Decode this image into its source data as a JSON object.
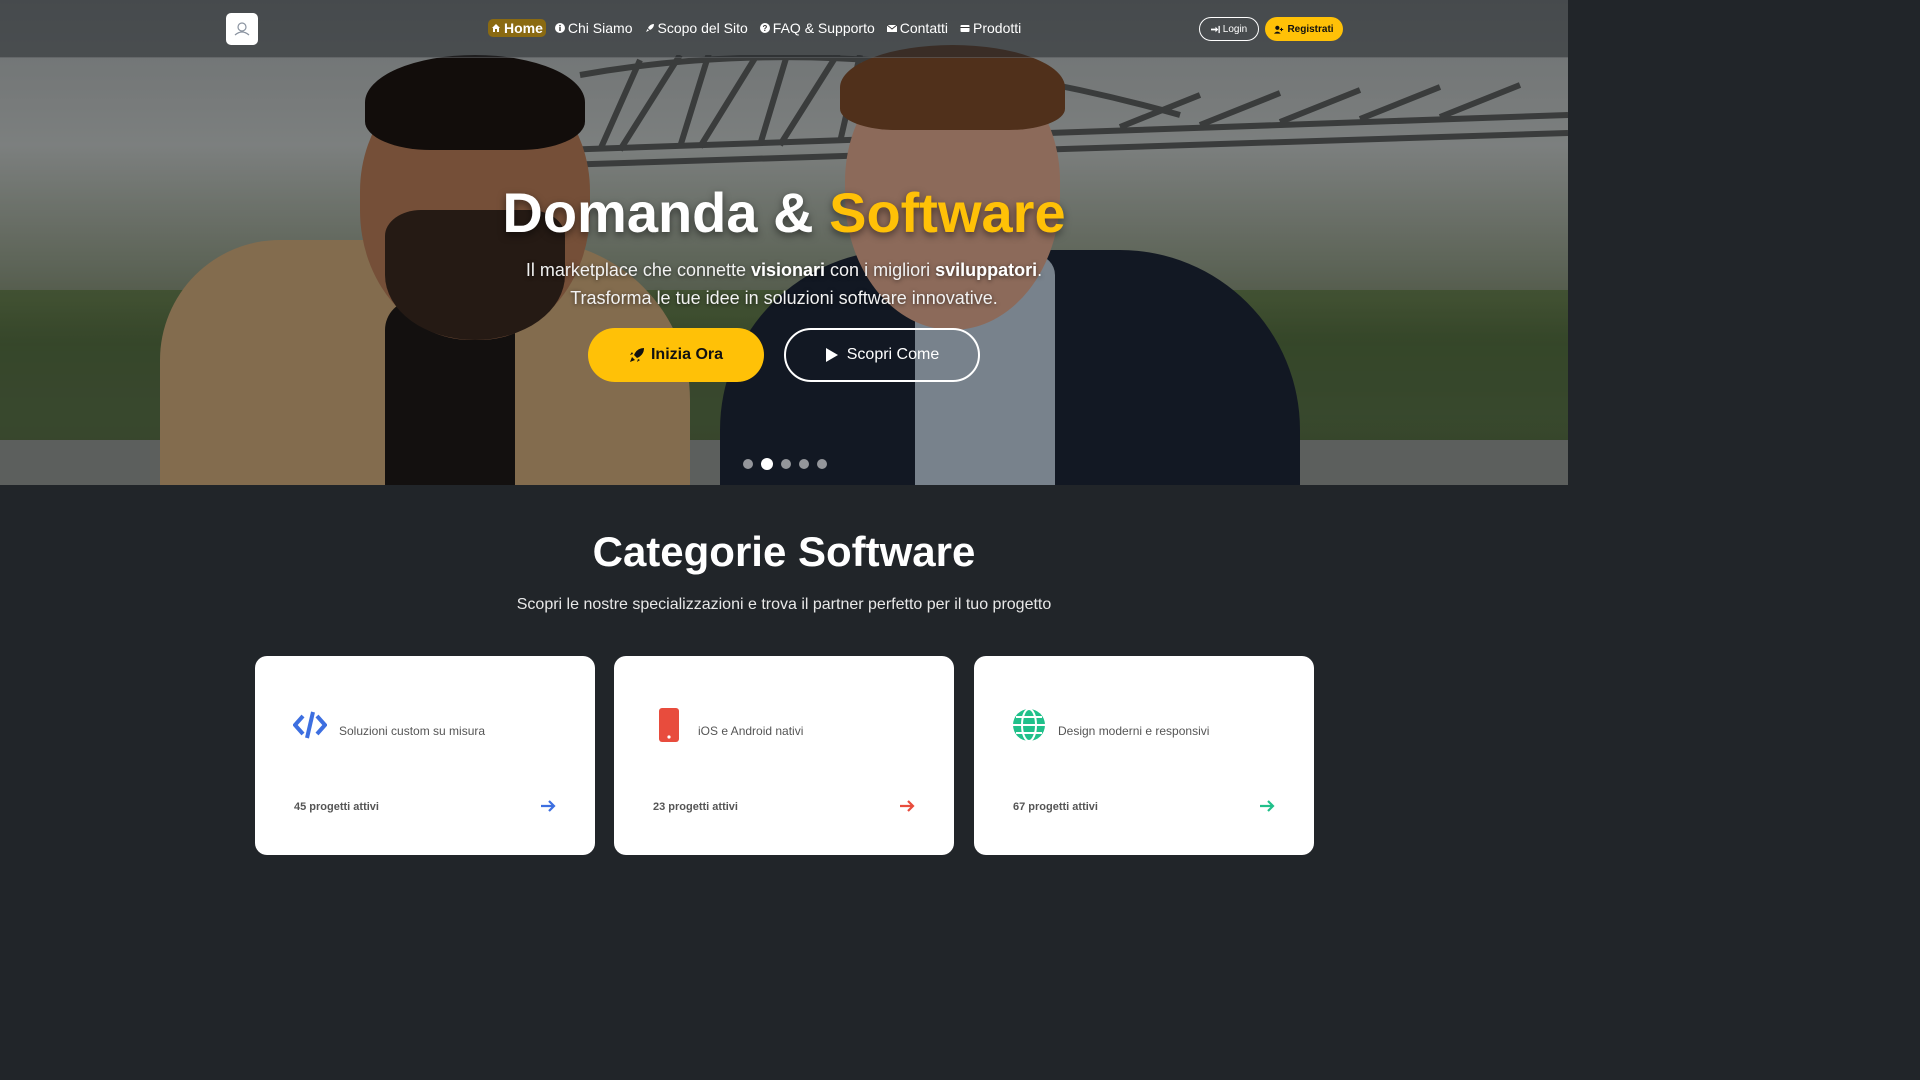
{
  "nav": {
    "items": [
      {
        "label": "Home",
        "icon": "home-icon",
        "active": true
      },
      {
        "label": "Chi Siamo",
        "icon": "info-icon"
      },
      {
        "label": "Scopo del Sito",
        "icon": "rocket-icon"
      },
      {
        "label": "FAQ & Supporto",
        "icon": "question-icon"
      },
      {
        "label": "Contatti",
        "icon": "envelope-icon"
      },
      {
        "label": "Prodotti",
        "icon": "box-icon"
      }
    ],
    "login_label": "Login",
    "register_label": "Registrati"
  },
  "hero": {
    "title_part1": "Domanda & ",
    "title_highlight": "Software",
    "subtitle_line1_a": "Il marketplace che connette ",
    "subtitle_bold1": "visionari",
    "subtitle_line1_b": " con i migliori ",
    "subtitle_bold2": "sviluppatori",
    "subtitle_line1_c": ".",
    "subtitle_line2": "Trasforma le tue idee in soluzioni software innovative.",
    "cta_primary": "Inizia Ora",
    "cta_secondary": "Scopri Come",
    "carousel_slides": 5,
    "carousel_active_index": 1
  },
  "categories": {
    "title": "Categorie Software",
    "subtitle": "Scopri le nostre specializzazioni e trova il partner perfetto per il tuo progetto",
    "cards": [
      {
        "icon": "code-icon",
        "description": "Soluzioni custom su misura",
        "count": "45 progetti attivi",
        "color": "#3d6fe0"
      },
      {
        "icon": "mobile-icon",
        "description": "iOS e Android nativi",
        "count": "23 progetti attivi",
        "color": "#e84c3d"
      },
      {
        "icon": "globe-icon",
        "description": "Design moderni e responsivi",
        "count": "67 progetti attivi",
        "color": "#20c08a"
      }
    ]
  },
  "colors": {
    "accent": "#ffc107",
    "dark_bg": "#212529"
  }
}
